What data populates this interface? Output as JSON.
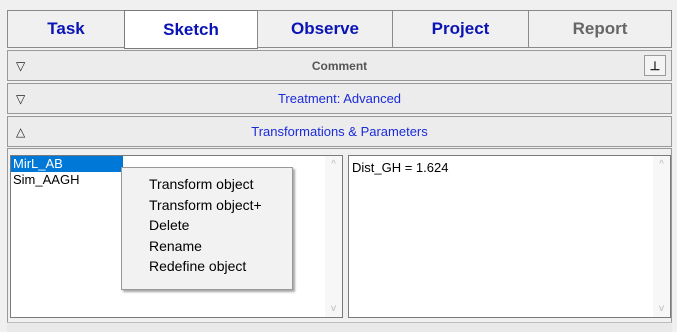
{
  "tabs": [
    {
      "label": "Task",
      "active": false,
      "disabled": false
    },
    {
      "label": "Sketch",
      "active": true,
      "disabled": false
    },
    {
      "label": "Observe",
      "active": false,
      "disabled": false
    },
    {
      "label": "Project",
      "active": false,
      "disabled": false
    },
    {
      "label": "Report",
      "active": false,
      "disabled": true
    }
  ],
  "sections": {
    "comment": {
      "title": "Comment",
      "icon": "triangle-down-icon",
      "pin_glyph": "⊥",
      "title_color": "#555555"
    },
    "treatment": {
      "title": "Treatment: Advanced",
      "icon": "triangle-down-icon",
      "title_color": "#1a2ad8"
    },
    "transformations": {
      "title": "Transformations & Parameters",
      "icon": "triangle-up-icon",
      "title_color": "#1a2ad8"
    }
  },
  "glyphs": {
    "down": "▽",
    "up": "△",
    "scroll_up": "^",
    "scroll_down": "v"
  },
  "object_list": [
    {
      "name": "MirL_AB",
      "selected": true
    },
    {
      "name": "Sim_AAGH",
      "selected": false
    }
  ],
  "parameters_text": "Dist_GH = 1.624",
  "context_menu": [
    "Transform object",
    "Transform object+",
    "Delete",
    "Rename",
    "Redefine object"
  ],
  "colors": {
    "tab_text": "#0a14b4",
    "selection": "#0078d7"
  }
}
